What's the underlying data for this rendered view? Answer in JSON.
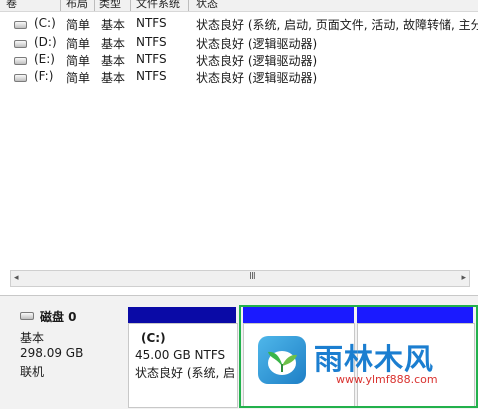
{
  "header": {
    "col_volume": "卷",
    "col_layout": "布局",
    "col_type": "类型",
    "col_fs": "文件系统",
    "col_status": "状态"
  },
  "volumes": [
    {
      "name": "(C:)",
      "layout": "简单",
      "type": "基本",
      "fs": "NTFS",
      "status": "状态良好 (系统, 启动, 页面文件, 活动, 故障转储, 主分"
    },
    {
      "name": "(D:)",
      "layout": "简单",
      "type": "基本",
      "fs": "NTFS",
      "status": "状态良好 (逻辑驱动器)"
    },
    {
      "name": "(E:)",
      "layout": "简单",
      "type": "基本",
      "fs": "NTFS",
      "status": "状态良好 (逻辑驱动器)"
    },
    {
      "name": "(F:)",
      "layout": "简单",
      "type": "基本",
      "fs": "NTFS",
      "status": "状态良好 (逻辑驱动器)"
    }
  ],
  "scrollbar": {
    "left_arrow": "◂",
    "right_arrow": "▸",
    "grip": "III"
  },
  "disk": {
    "title": "磁盘 0",
    "type": "基本",
    "size": "298.09 GB",
    "state": "联机"
  },
  "partition_c": {
    "name": "(C:)",
    "size_fs": "45.00 GB NTFS",
    "status": "状态良好 (系统, 启"
  },
  "watermark": {
    "brand": "雨林木风",
    "url": "www.ylmf888.com"
  },
  "colors": {
    "partition_bar": "#0a0aa6",
    "highlight_bar": "#1a1aff",
    "selection_border": "#22b14c"
  }
}
